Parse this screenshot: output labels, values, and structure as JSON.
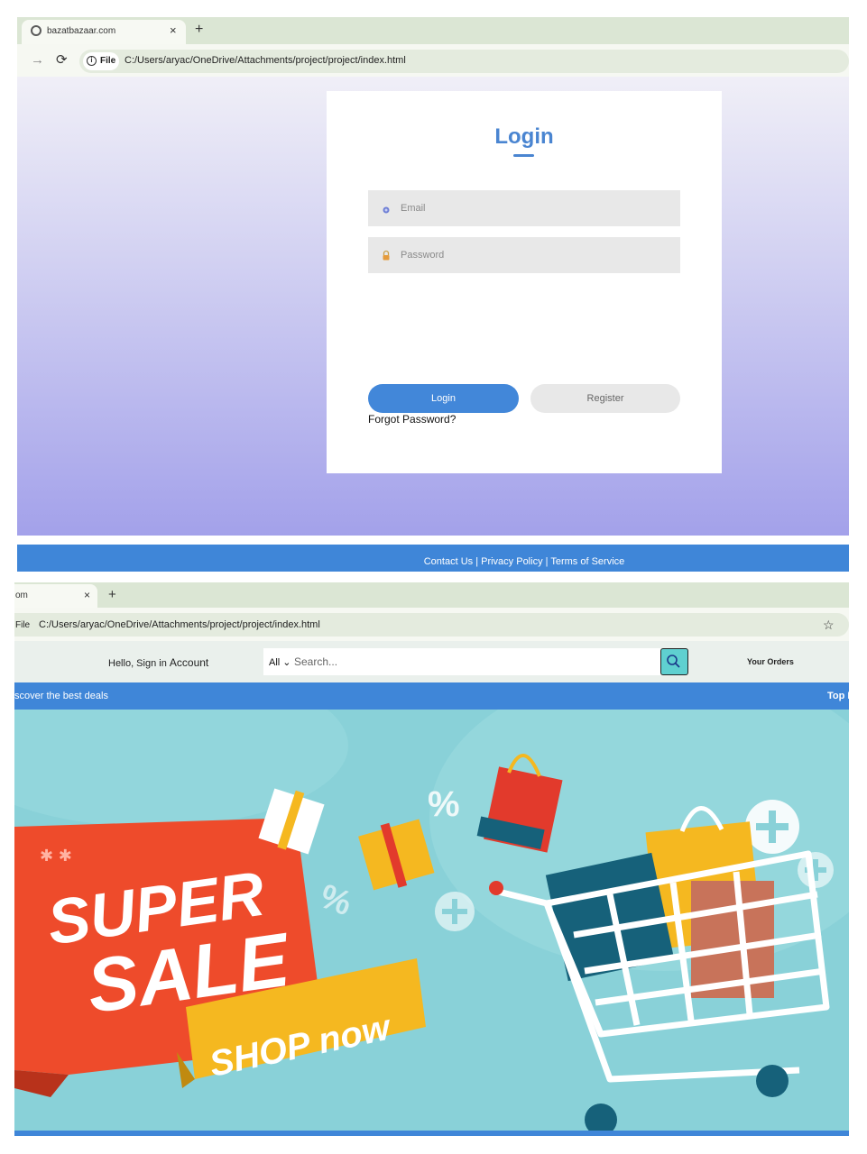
{
  "window1": {
    "tab_title": "bazatbazaar.com",
    "tab_close": "×",
    "new_tab": "+",
    "forward": "→",
    "reload": "⟳",
    "info": "i",
    "file_label": "File",
    "url": "C:/Users/aryac/OneDrive/Attachments/project/project/index.html"
  },
  "login": {
    "title": "Login",
    "email_placeholder": "Email",
    "password_placeholder": "Password",
    "login_button": "Login",
    "register_button": "Register",
    "forgot_password": "Forgot Password?"
  },
  "footer": {
    "links": "Contact Us | Privacy Policy | Terms of Service"
  },
  "window2": {
    "tab_title": "om",
    "tab_close": "×",
    "new_tab": "+",
    "file_label": "File",
    "url": "C:/Users/aryac/OneDrive/Attachments/project/project/index.html",
    "star": "☆"
  },
  "shop": {
    "greeting": "Hello, Sign in",
    "account": "Account",
    "search_category": "All ⌄",
    "search_placeholder": "Search...",
    "orders": "Your Orders",
    "deals_left": "scover the best deals",
    "deals_right": "Top D"
  },
  "banner": {
    "line1": "SUPER",
    "line2": "SALE",
    "ribbon": "SHOP now",
    "percent": "%"
  },
  "colors": {
    "accent_blue": "#4287d9",
    "banner_bg": "#89d1d8",
    "sale_red": "#ee4b2b",
    "ribbon_yellow": "#f5b820"
  }
}
